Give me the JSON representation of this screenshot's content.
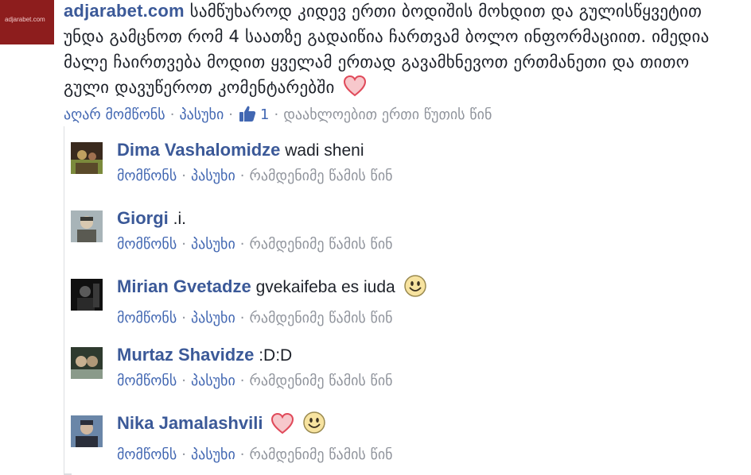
{
  "main_comment": {
    "author": "adjarabet.com",
    "avatar_label": "adjarabet.com",
    "text": "სამწუხაროდ კიდევ ერთი ბოდიშის მოხდით და გულისწყვეტით უნდა გამცნოთ რომ 4 საათზე გადაიწია ჩართვამ ბოლო ინფორმაციით. იმედია მალე ჩაირთვება მოდით ყველამ ერთად გავამხნევოთ ერთმანეთი და თითო გული დავუწეროთ კომენტარებში",
    "unlike_label": "აღარ მომწონს",
    "reply_label": "პასუხი",
    "like_count": "1",
    "time": "დაახლოებით ერთი წუთის წინ",
    "separator": "·"
  },
  "replies": [
    {
      "author": "Dima Vashalomidze",
      "text": "wadi sheni",
      "emoji": "",
      "heart": false,
      "like_label": "მომწონს",
      "reply_label": "პასუხი",
      "time": "რამდენიმე წამის წინ",
      "separator": "·",
      "avatar_colors": [
        "#3a2a1e",
        "#7b8a3c",
        "#c0a060"
      ]
    },
    {
      "author": "Giorgi",
      "text": ".i.",
      "emoji": "",
      "heart": false,
      "like_label": "მომწონს",
      "reply_label": "პასუხი",
      "time": "რამდენიმე წამის წინ",
      "separator": "·",
      "avatar_colors": [
        "#a8b4b8",
        "#5a5a52",
        "#d8d8d0"
      ]
    },
    {
      "author": "Mirian Gvetadze",
      "text": "gvekaifeba es iuda",
      "emoji": "smiley-emoji",
      "heart": false,
      "like_label": "მომწონს",
      "reply_label": "პასუხი",
      "time": "რამდენიმე წამის წინ",
      "separator": "·",
      "avatar_colors": [
        "#101010",
        "#3a3a3a",
        "#7a7a7a"
      ]
    },
    {
      "author": "Murtaz Shavidze",
      "text": ":D:D",
      "emoji": "",
      "heart": false,
      "like_label": "მომწონს",
      "reply_label": "პასუხი",
      "time": "რამდენიმე წამის წინ",
      "separator": "·",
      "avatar_colors": [
        "#2e3a2e",
        "#8a9a8a",
        "#c8b090"
      ]
    },
    {
      "author": "Nika Jamalashvili",
      "text": "",
      "emoji": "smiley-emoji",
      "heart": true,
      "like_label": "მომწონს",
      "reply_label": "პასუხი",
      "time": "რამდენიმე წამის წინ",
      "separator": "·",
      "avatar_colors": [
        "#6a86a8",
        "#2a2e3a",
        "#d0b8a0"
      ]
    }
  ],
  "colors": {
    "link": "#3b5998",
    "action": "#4267b2",
    "muted": "#90949c",
    "text": "#1d2129",
    "heart": "#f25268",
    "emoji_yellow": "#f7d774"
  }
}
